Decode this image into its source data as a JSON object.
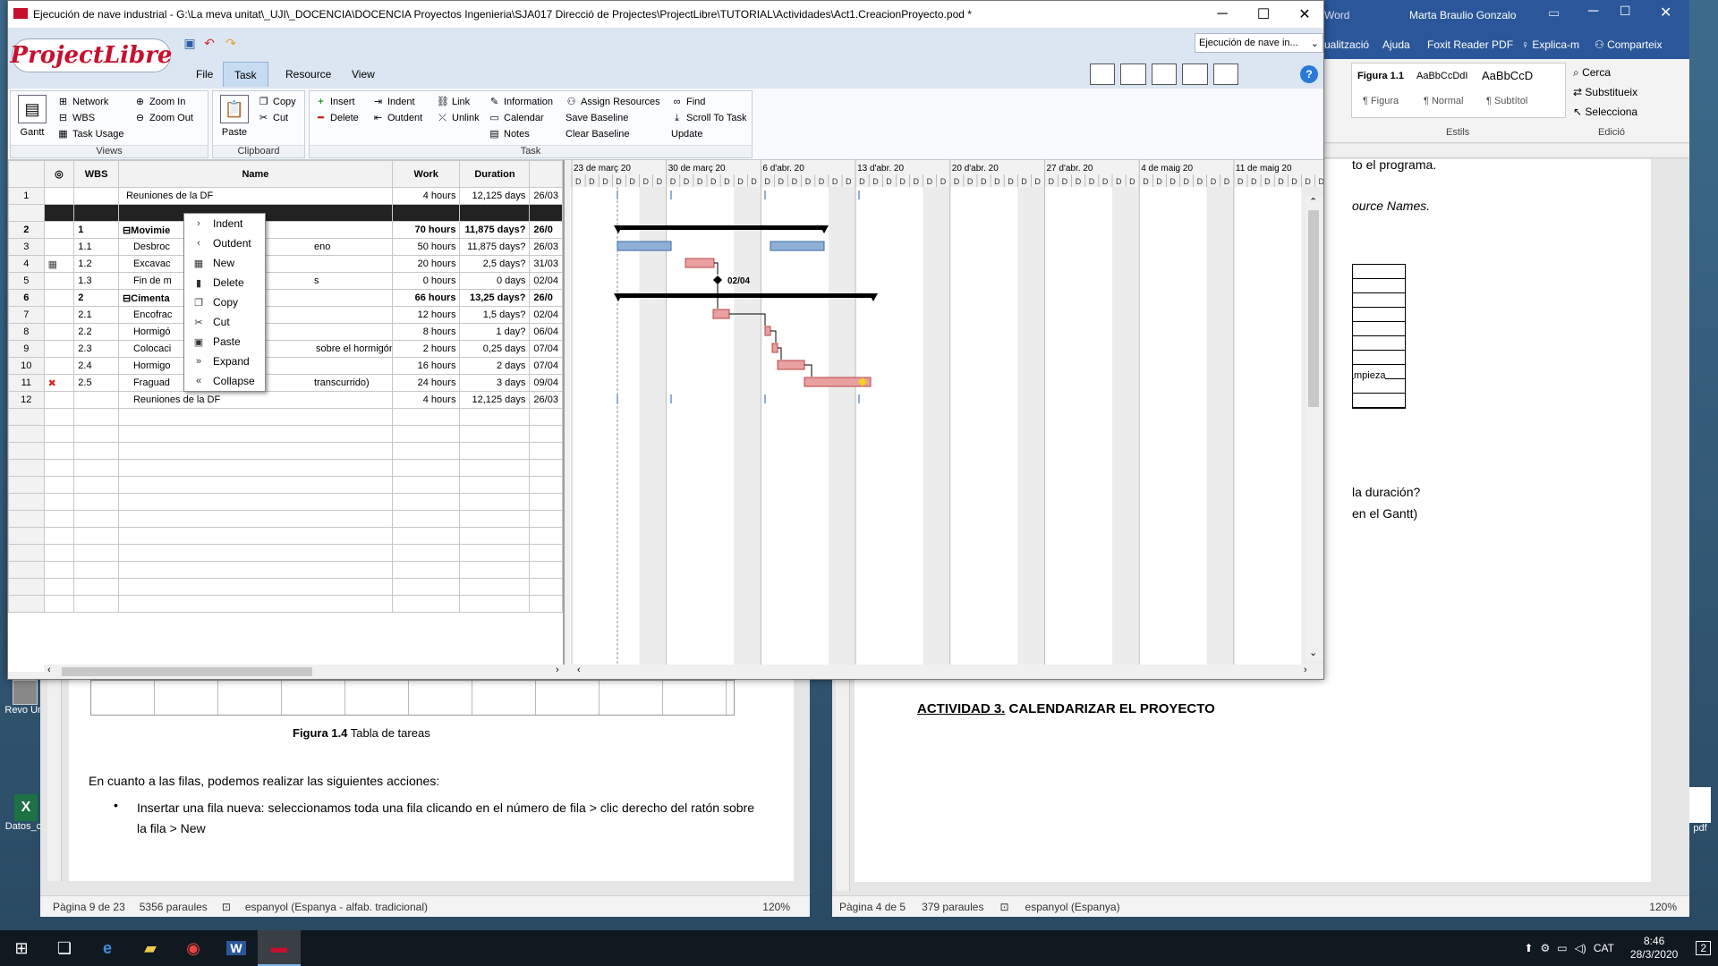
{
  "projectlibre": {
    "window_title": "Ejecución de nave industrial - G:\\La meva unitat\\_UJI\\_DOCENCIA\\DOCENCIA Proyectos Ingenieria\\SJA017 Direcció de Projectes\\ProjectLibre\\TUTORIAL\\Actividades\\Act1.CreacionProyecto.pod *",
    "logo": "ProjectLibre",
    "menu_tabs": [
      "File",
      "Task",
      "Resource",
      "View"
    ],
    "selected_tab": "Task",
    "project_select": "Ejecución de nave in...",
    "ribbon": {
      "views": {
        "label": "Views",
        "gantt": "Gantt",
        "network": "Network",
        "wbs": "WBS",
        "task_usage": "Task Usage",
        "zoom_in": "Zoom In",
        "zoom_out": "Zoom Out"
      },
      "clipboard": {
        "label": "Clipboard",
        "paste": "Paste",
        "copy": "Copy",
        "cut": "Cut"
      },
      "task": {
        "label": "Task",
        "insert": "Insert",
        "delete": "Delete",
        "indent": "Indent",
        "outdent": "Outdent",
        "link": "Link",
        "unlink": "Unlink",
        "information": "Information",
        "calendar": "Calendar",
        "notes": "Notes",
        "assign_resources": "Assign Resources",
        "save_baseline": "Save Baseline",
        "clear_baseline": "Clear Baseline",
        "find": "Find",
        "scroll_to_task": "Scroll To Task",
        "update": "Update"
      }
    },
    "table": {
      "columns": [
        "",
        "WBS",
        "Name",
        "Work",
        "Duration",
        ""
      ],
      "rows": [
        {
          "n": "1",
          "ind": "",
          "wbs": "",
          "name": "Reuniones de la DF",
          "work": "4 hours",
          "dur": "12,125 days",
          "start": "26/03",
          "sum": false
        },
        {
          "n": "",
          "ind": "",
          "wbs": "",
          "name": "",
          "work": "",
          "dur": "",
          "start": "",
          "sum": false,
          "selected": true
        },
        {
          "n": "2",
          "ind": "",
          "wbs": "1",
          "name": "⊟Movimie",
          "work": "70 hours",
          "dur": "11,875 days?",
          "start": "26/0",
          "sum": true
        },
        {
          "n": "3",
          "ind": "",
          "wbs": "1.1",
          "name": "Desbroc",
          "work": "50 hours",
          "dur": "11,875 days?",
          "start": "26/03",
          "sum": false
        },
        {
          "n": "4",
          "ind": "cal",
          "wbs": "1.2",
          "name": "Excavac",
          "work": "20 hours",
          "dur": "2,5 days?",
          "start": "31/03",
          "sum": false
        },
        {
          "n": "5",
          "ind": "",
          "wbs": "1.3",
          "name": "Fin de m",
          "work": "0 hours",
          "dur": "0 days",
          "start": "02/04",
          "sum": false
        },
        {
          "n": "6",
          "ind": "",
          "wbs": "2",
          "name": "⊟Cimenta",
          "work": "66 hours",
          "dur": "13,25 days?",
          "start": "26/0",
          "sum": true
        },
        {
          "n": "7",
          "ind": "",
          "wbs": "2.1",
          "name": "Encofrac",
          "work": "12 hours",
          "dur": "1,5 days?",
          "start": "02/04",
          "sum": false
        },
        {
          "n": "8",
          "ind": "",
          "wbs": "2.2",
          "name": "Hormigó",
          "work": "8 hours",
          "dur": "1 day?",
          "start": "06/04",
          "sum": false
        },
        {
          "n": "9",
          "ind": "",
          "wbs": "2.3",
          "name": "Colocaci",
          "work": "2 hours",
          "dur": "0,25 days",
          "start": "07/04",
          "sum": false
        },
        {
          "n": "10",
          "ind": "",
          "wbs": "2.4",
          "name": "Hormigo",
          "work": "16 hours",
          "dur": "2 days",
          "start": "07/04",
          "sum": false
        },
        {
          "n": "11",
          "ind": "err",
          "wbs": "2.5",
          "name": "Fraguad",
          "work": "24 hours",
          "dur": "3 days",
          "start": "09/04",
          "sum": false
        },
        {
          "n": "12",
          "ind": "",
          "wbs": "",
          "name": "Reuniones de la DF",
          "work": "4 hours",
          "dur": "12,125 days",
          "start": "26/03",
          "sum": false
        }
      ],
      "name_suffixes": {
        "3": "eno",
        "5": "s",
        "9": "sobre el hormigón de limpieza",
        "11": "transcurrido)"
      }
    },
    "gantt": {
      "weeks": [
        "23 de març 20",
        "30 de març 20",
        "6 d'abr. 20",
        "13 d'abr. 20",
        "20 d'abr. 20",
        "27 d'abr. 20",
        "4 de maig 20",
        "11 de maig 20"
      ],
      "day_letter": "D",
      "milestone_label": "02/04"
    },
    "context_menu": [
      "Indent",
      "Outdent",
      "New",
      "Delete",
      "Copy",
      "Cut",
      "Paste",
      "Expand",
      "Collapse"
    ]
  },
  "word_left": {
    "caption_bold": "Figura 1.4",
    "caption_rest": " Tabla de tareas",
    "para1": "En cuanto a las filas, podemos realizar las siguientes acciones:",
    "bullet1": "Insertar una fila nueva: seleccionamos toda una fila clicando en el número de fila > clic derecho del ratón sobre la fila > New",
    "status_page": "Pàgina 9 de 23",
    "status_words": "5356 paraules",
    "status_lang": "espanyol (Espanya - alfab. tradicional)",
    "zoom": "120%"
  },
  "word_right": {
    "title_app": "Word",
    "user": "Marta Braulio Gonzalo",
    "ribbon_tabs": [
      "ualització",
      "Ajuda",
      "Foxit Reader PDF",
      "Explica-m",
      "Comparteix"
    ],
    "styles": [
      "Figura 1.1",
      "AaBbCcDdI",
      "AaBbCcD"
    ],
    "style_names": [
      "¶ Figura",
      "¶ Normal",
      "¶ Subtítol"
    ],
    "styles_group": "Estils",
    "edit_group": "Edició",
    "edit_items": [
      "Cerca",
      "Substitueix",
      "Selecciona"
    ],
    "text1": "to el programa.",
    "text2": "ource Names.",
    "cell_text": "mpieza",
    "text3": "la duración?",
    "text4": "en el Gantt)",
    "heading_u": "ACTIVIDAD 3.",
    "heading_rest": " CALENDARIZAR EL PROYECTO",
    "status_page": "Pàgina 4 de 5",
    "status_words": "379 paraules",
    "status_lang": "espanyol (Espanya)",
    "zoom": "120%"
  },
  "desktop": {
    "icon1": "Revo Uni",
    "icon2": "Datos_co",
    "icon3": "pdf"
  },
  "taskbar": {
    "lang": "CAT",
    "time": "8:46",
    "date": "28/3/2020",
    "notif": "2"
  }
}
